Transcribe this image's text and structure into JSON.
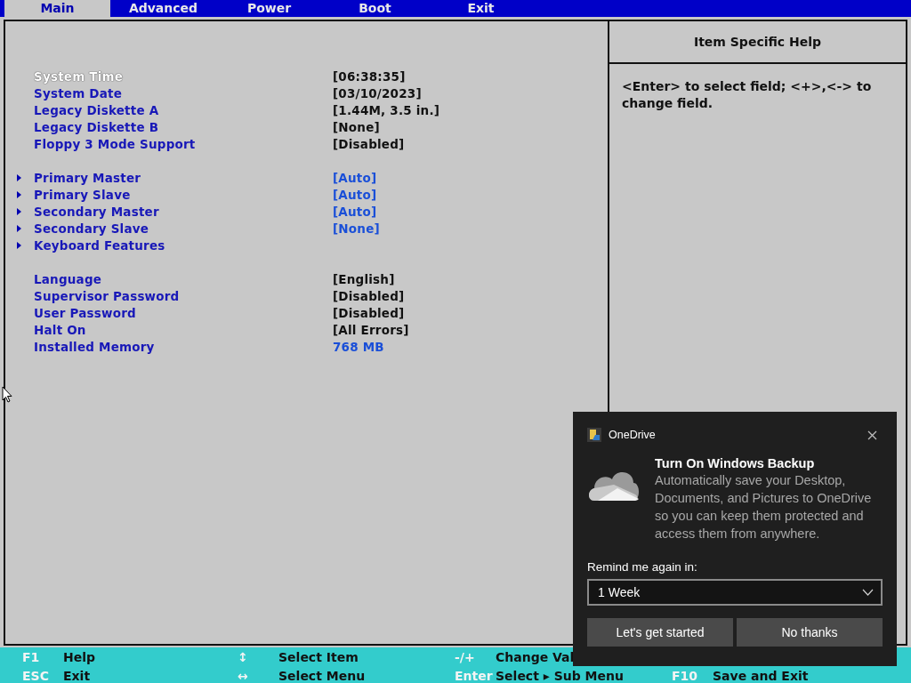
{
  "tabs": [
    {
      "label": "Main",
      "selected": true
    },
    {
      "label": "Advanced",
      "selected": false
    },
    {
      "label": "Power",
      "selected": false
    },
    {
      "label": "Boot",
      "selected": false
    },
    {
      "label": "Exit",
      "selected": false
    }
  ],
  "settings_groups": [
    {
      "items": [
        {
          "label": "System Time",
          "value": "[06:38:35]",
          "kind": "editable",
          "submenu": false,
          "selected": true
        },
        {
          "label": "System Date",
          "value": "[03/10/2023]",
          "kind": "editable",
          "submenu": false,
          "selected": false
        },
        {
          "label": "Legacy Diskette A",
          "value": "[1.44M, 3.5 in.]",
          "kind": "editable",
          "submenu": false,
          "selected": false
        },
        {
          "label": "Legacy Diskette B",
          "value": "[None]",
          "kind": "editable",
          "submenu": false,
          "selected": false
        },
        {
          "label": "Floppy 3 Mode Support",
          "value": "[Disabled]",
          "kind": "editable",
          "submenu": false,
          "selected": false
        }
      ]
    },
    {
      "items": [
        {
          "label": "Primary Master",
          "value": "[Auto]",
          "kind": "info",
          "submenu": true,
          "selected": false
        },
        {
          "label": "Primary Slave",
          "value": "[Auto]",
          "kind": "info",
          "submenu": true,
          "selected": false
        },
        {
          "label": "Secondary Master",
          "value": "[Auto]",
          "kind": "info",
          "submenu": true,
          "selected": false
        },
        {
          "label": "Secondary Slave",
          "value": "[None]",
          "kind": "info",
          "submenu": true,
          "selected": false
        },
        {
          "label": "Keyboard Features",
          "submenu": true,
          "selected": false
        }
      ]
    },
    {
      "items": [
        {
          "label": "Language",
          "value": "[English]",
          "kind": "editable",
          "submenu": false,
          "selected": false
        },
        {
          "label": "Supervisor Password",
          "value": "[Disabled]",
          "kind": "editable",
          "submenu": false,
          "selected": false
        },
        {
          "label": "User Password",
          "value": "[Disabled]",
          "kind": "editable",
          "submenu": false,
          "selected": false
        },
        {
          "label": "Halt On",
          "value": "[All Errors]",
          "kind": "editable",
          "submenu": false,
          "selected": false
        },
        {
          "label": "Installed Memory",
          "value": "768 MB",
          "kind": "info",
          "submenu": false,
          "selected": false
        }
      ]
    }
  ],
  "help_panel": {
    "title": "Item Specific Help",
    "text": "<Enter> to select field; <+>,<-> to change field."
  },
  "key_legend": [
    [
      {
        "key": "F1",
        "action": "Help"
      },
      {
        "key": "↕",
        "action": "Select Item"
      },
      {
        "key": "-/+",
        "action": "Change Val"
      }
    ],
    [
      {
        "key": "ESC",
        "action": "Exit"
      },
      {
        "key": "↔",
        "action": "Select Menu"
      },
      {
        "key": "Enter",
        "action": "Select ▸ Sub Menu"
      },
      {
        "key": "F10",
        "action": "Save and Exit"
      }
    ]
  ],
  "notification": {
    "app": "OneDrive",
    "title": "Turn On Windows Backup",
    "message": "Automatically save your Desktop, Documents, and Pictures to OneDrive so you can keep them protected and access them from anywhere.",
    "remind_label": "Remind me again in:",
    "remind_value": "1 Week",
    "buttons": [
      "Let's get started",
      "No thanks"
    ]
  }
}
